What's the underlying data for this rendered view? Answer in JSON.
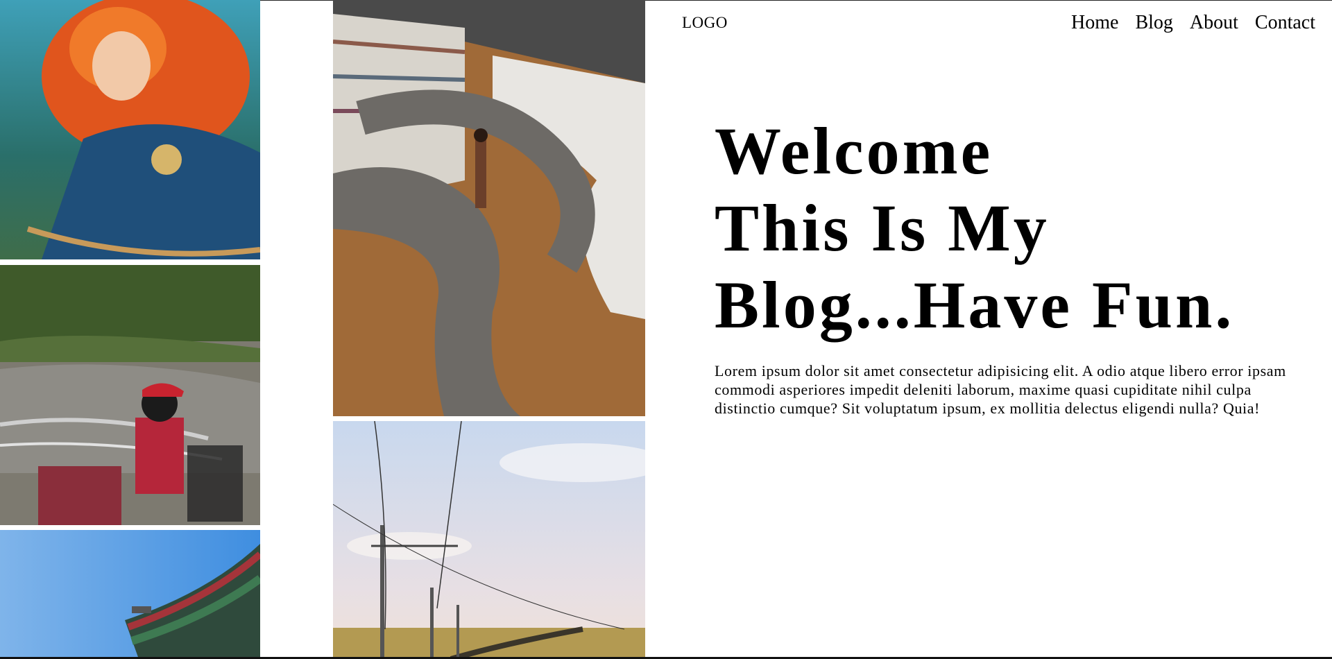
{
  "header": {
    "logo": "LOGO",
    "nav": [
      "Home",
      "Blog",
      "About",
      "Contact"
    ]
  },
  "hero": {
    "title_lines": [
      "Welcome",
      "This Is My",
      "Blog...Have Fun."
    ],
    "paragraph": "Lorem ipsum dolor sit amet consectetur adipisicing elit. A odio atque libero error ipsam commodi asperiores impedit deleniti laborum, maxime quasi cupiditate nihil culpa distinctio cumque? Sit voluptatum ipsum, ex mollitia delectus eligendi nulla? Quia!"
  },
  "gallery": [
    {
      "icon": "animated-archer-photo"
    },
    {
      "icon": "riverside-woman-photo"
    },
    {
      "icon": "temple-roof-photo"
    },
    {
      "icon": "library-shelves-photo"
    },
    {
      "icon": "railway-power-lines-photo"
    }
  ],
  "colors": {
    "background": "#ffffff",
    "text": "#000000"
  }
}
